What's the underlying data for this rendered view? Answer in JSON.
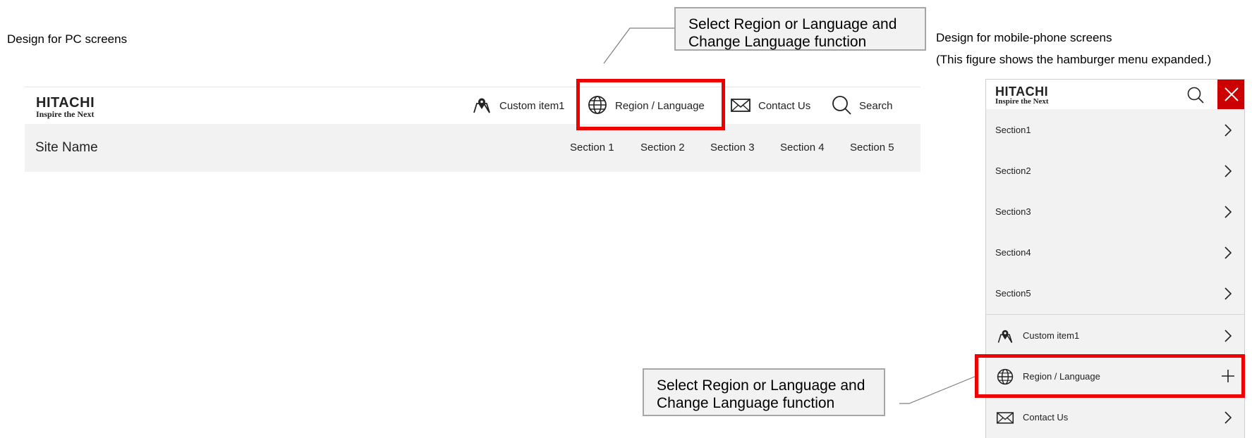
{
  "captions": {
    "pc": "Design for PC screens",
    "mobile_line1": "Design for mobile-phone screens",
    "mobile_line2": "(This figure shows the hamburger menu expanded.)"
  },
  "callout": {
    "top": {
      "line1": "Select Region or Language and",
      "line2": "Change Language function"
    },
    "bottom": {
      "line1": "Select Region or Language and",
      "line2": "Change Language function"
    }
  },
  "logo": {
    "brand": "HITACHI",
    "tagline": "Inspire the Next"
  },
  "pc": {
    "utility": [
      {
        "label": "Custom item1",
        "icon": "map-pin-icon"
      },
      {
        "label": "Region / Language",
        "icon": "globe-icon"
      },
      {
        "label": "Contact Us",
        "icon": "envelope-icon"
      },
      {
        "label": "Search",
        "icon": "search-icon"
      }
    ],
    "site_name": "Site Name",
    "sections": [
      "Section 1",
      "Section 2",
      "Section 3",
      "Section 4",
      "Section 5"
    ]
  },
  "mobile": {
    "sections": [
      "Section1",
      "Section2",
      "Section3",
      "Section4",
      "Section5"
    ],
    "utility": [
      {
        "label": "Custom item1",
        "icon": "map-pin-icon",
        "action": "chevron-right-icon"
      },
      {
        "label": "Region / Language",
        "icon": "globe-icon",
        "action": "plus-icon"
      },
      {
        "label": "Contact Us",
        "icon": "envelope-icon",
        "action": "chevron-right-icon"
      }
    ]
  },
  "colors": {
    "highlight": "#ee0000",
    "close_button": "#cc0000",
    "nav_bg": "#f2f2f2",
    "callout_border": "#a6a6a6"
  }
}
